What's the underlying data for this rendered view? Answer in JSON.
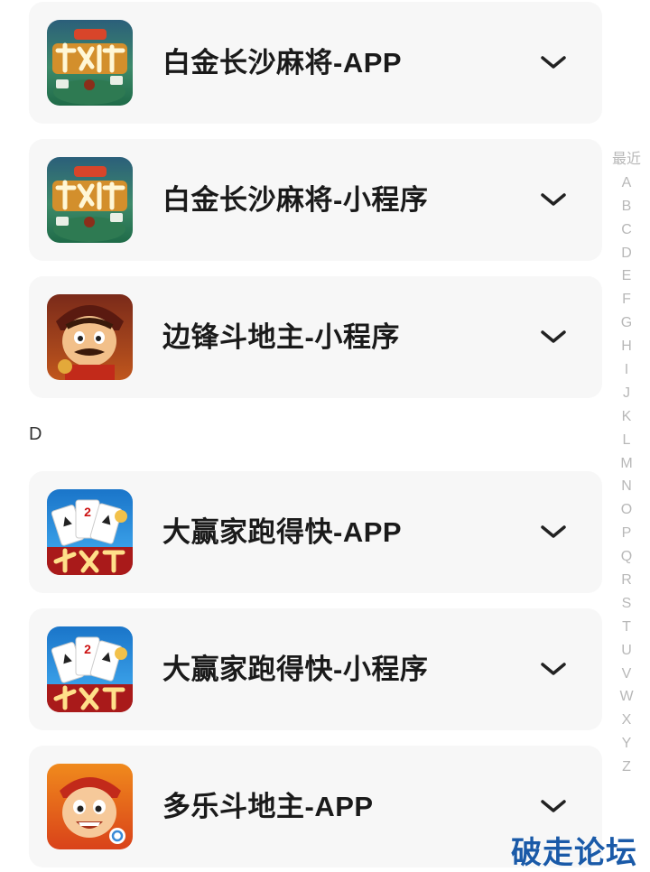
{
  "list": {
    "items": [
      {
        "title": "白金长沙麻将-APP",
        "icon": "changsha-mahjong-icon",
        "expand_icon": "chevron-down-icon"
      },
      {
        "title": "白金长沙麻将-小程序",
        "icon": "changsha-mahjong-icon",
        "expand_icon": "chevron-down-icon"
      },
      {
        "title": "边锋斗地主-小程序",
        "icon": "bianfeng-doudizhu-icon",
        "expand_icon": "chevron-down-icon"
      },
      {
        "title": "大赢家跑得快-APP",
        "icon": "dayingjia-paodekuai-icon",
        "expand_icon": "chevron-down-icon"
      },
      {
        "title": "大赢家跑得快-小程序",
        "icon": "dayingjia-paodekuai-icon",
        "expand_icon": "chevron-down-icon"
      },
      {
        "title": "多乐斗地主-APP",
        "icon": "duole-doudizhu-icon",
        "expand_icon": "chevron-down-icon"
      }
    ],
    "section_header": "D"
  },
  "index_bar": {
    "labels": [
      "最近",
      "A",
      "B",
      "C",
      "D",
      "E",
      "F",
      "G",
      "H",
      "I",
      "J",
      "K",
      "L",
      "M",
      "N",
      "O",
      "P",
      "Q",
      "R",
      "S",
      "T",
      "U",
      "V",
      "W",
      "X",
      "Y",
      "Z"
    ]
  },
  "watermark": "破走论坛",
  "colors": {
    "card_bg": "#f7f7f7",
    "title": "#1a1a1a",
    "index_text": "#b8b8b8",
    "watermark": "#1a5aa8"
  }
}
